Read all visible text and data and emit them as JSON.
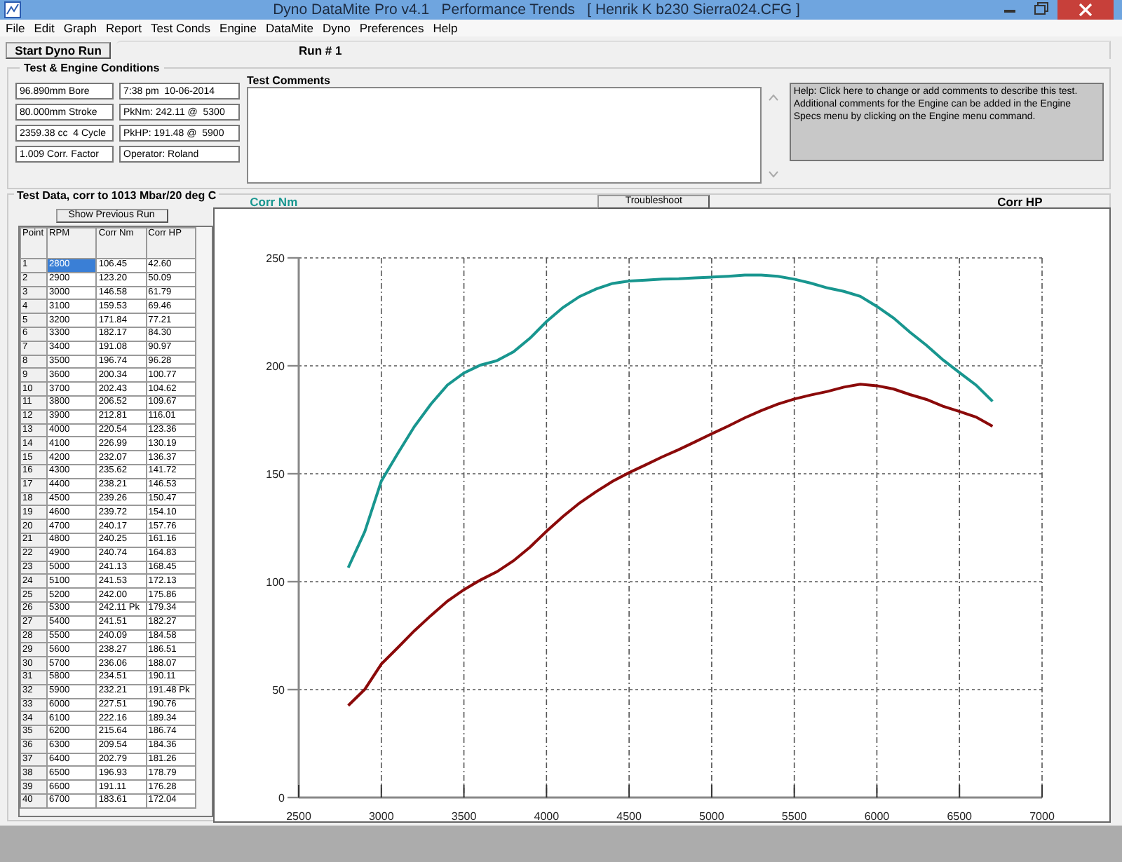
{
  "window": {
    "title": "Dyno DataMite Pro v4.1   Performance Trends   [ Henrik K b230 Sierra024.CFG ]"
  },
  "menu": [
    "File",
    "Edit",
    "Graph",
    "Report",
    "Test Conds",
    "Engine",
    "DataMite",
    "Dyno",
    "Preferences",
    "Help"
  ],
  "toolbar": {
    "start_button": "Start Dyno Run",
    "run_tab": "Run # 1"
  },
  "conditions": {
    "title": "Test & Engine Conditions",
    "fields": [
      "96.890mm Bore",
      "7:38 pm  10-06-2014",
      "80.000mm Stroke",
      "PkNm: 242.11 @  5300",
      "2359.38 cc  4 Cycle",
      "PkHP: 191.48 @  5900",
      "1.009 Corr. Factor",
      "Operator: Roland"
    ]
  },
  "comments": {
    "label": "Test Comments",
    "help": "Help:  Click here to change or add comments to describe this test.  Additional comments for the Engine can be added in the Engine Specs menu by clicking on the Engine menu command."
  },
  "test_data": {
    "title": "Test Data, corr to 1013 Mbar/20 deg C",
    "show_previous_button": "Show Previous Run",
    "columns": [
      "Point",
      "RPM",
      "Corr Nm",
      "Corr HP"
    ],
    "rows": [
      {
        "cells": [
          "1",
          "2800",
          "106.45",
          "42.60"
        ],
        "selected": true
      },
      {
        "cells": [
          "2",
          "2900",
          "123.20",
          "50.09"
        ],
        "selected": false
      },
      {
        "cells": [
          "3",
          "3000",
          "146.58",
          "61.79"
        ],
        "selected": false
      },
      {
        "cells": [
          "4",
          "3100",
          "159.53",
          "69.46"
        ],
        "selected": false
      },
      {
        "cells": [
          "5",
          "3200",
          "171.84",
          "77.21"
        ],
        "selected": false
      },
      {
        "cells": [
          "6",
          "3300",
          "182.17",
          "84.30"
        ],
        "selected": false
      },
      {
        "cells": [
          "7",
          "3400",
          "191.08",
          "90.97"
        ],
        "selected": false
      },
      {
        "cells": [
          "8",
          "3500",
          "196.74",
          "96.28"
        ],
        "selected": false
      },
      {
        "cells": [
          "9",
          "3600",
          "200.34",
          "100.77"
        ],
        "selected": false
      },
      {
        "cells": [
          "10",
          "3700",
          "202.43",
          "104.62"
        ],
        "selected": false
      },
      {
        "cells": [
          "11",
          "3800",
          "206.52",
          "109.67"
        ],
        "selected": false
      },
      {
        "cells": [
          "12",
          "3900",
          "212.81",
          "116.01"
        ],
        "selected": false
      },
      {
        "cells": [
          "13",
          "4000",
          "220.54",
          "123.36"
        ],
        "selected": false
      },
      {
        "cells": [
          "14",
          "4100",
          "226.99",
          "130.19"
        ],
        "selected": false
      },
      {
        "cells": [
          "15",
          "4200",
          "232.07",
          "136.37"
        ],
        "selected": false
      },
      {
        "cells": [
          "16",
          "4300",
          "235.62",
          "141.72"
        ],
        "selected": false
      },
      {
        "cells": [
          "17",
          "4400",
          "238.21",
          "146.53"
        ],
        "selected": false
      },
      {
        "cells": [
          "18",
          "4500",
          "239.26",
          "150.47"
        ],
        "selected": false
      },
      {
        "cells": [
          "19",
          "4600",
          "239.72",
          "154.10"
        ],
        "selected": false
      },
      {
        "cells": [
          "20",
          "4700",
          "240.17",
          "157.76"
        ],
        "selected": false
      },
      {
        "cells": [
          "21",
          "4800",
          "240.25",
          "161.16"
        ],
        "selected": false
      },
      {
        "cells": [
          "22",
          "4900",
          "240.74",
          "164.83"
        ],
        "selected": false
      },
      {
        "cells": [
          "23",
          "5000",
          "241.13",
          "168.45"
        ],
        "selected": false
      },
      {
        "cells": [
          "24",
          "5100",
          "241.53",
          "172.13"
        ],
        "selected": false
      },
      {
        "cells": [
          "25",
          "5200",
          "242.00",
          "175.86"
        ],
        "selected": false
      },
      {
        "cells": [
          "26",
          "5300",
          "242.11 Pk",
          "179.34"
        ],
        "selected": false
      },
      {
        "cells": [
          "27",
          "5400",
          "241.51",
          "182.27"
        ],
        "selected": false
      },
      {
        "cells": [
          "28",
          "5500",
          "240.09",
          "184.58"
        ],
        "selected": false
      },
      {
        "cells": [
          "29",
          "5600",
          "238.27",
          "186.51"
        ],
        "selected": false
      },
      {
        "cells": [
          "30",
          "5700",
          "236.06",
          "188.07"
        ],
        "selected": false
      },
      {
        "cells": [
          "31",
          "5800",
          "234.51",
          "190.11"
        ],
        "selected": false
      },
      {
        "cells": [
          "32",
          "5900",
          "232.21",
          "191.48 Pk"
        ],
        "selected": false
      },
      {
        "cells": [
          "33",
          "6000",
          "227.51",
          "190.76"
        ],
        "selected": false
      },
      {
        "cells": [
          "34",
          "6100",
          "222.16",
          "189.34"
        ],
        "selected": false
      },
      {
        "cells": [
          "35",
          "6200",
          "215.64",
          "186.74"
        ],
        "selected": false
      },
      {
        "cells": [
          "36",
          "6300",
          "209.54",
          "184.36"
        ],
        "selected": false
      },
      {
        "cells": [
          "37",
          "6400",
          "202.79",
          "181.26"
        ],
        "selected": false
      },
      {
        "cells": [
          "38",
          "6500",
          "196.93",
          "178.79"
        ],
        "selected": false
      },
      {
        "cells": [
          "39",
          "6600",
          "191.11",
          "176.28"
        ],
        "selected": false
      },
      {
        "cells": [
          "40",
          "6700",
          "183.61",
          "172.04"
        ],
        "selected": false
      }
    ]
  },
  "graph": {
    "troubleshoot_button": "Troubleshoot",
    "chart_data": {
      "type": "line",
      "grid": true,
      "x": [
        2800,
        2900,
        3000,
        3100,
        3200,
        3300,
        3400,
        3500,
        3600,
        3700,
        3800,
        3900,
        4000,
        4100,
        4200,
        4300,
        4400,
        4500,
        4600,
        4700,
        4800,
        4900,
        5000,
        5100,
        5200,
        5300,
        5400,
        5500,
        5600,
        5700,
        5800,
        5900,
        6000,
        6100,
        6200,
        6300,
        6400,
        6500,
        6600,
        6700
      ],
      "series": [
        {
          "name": "Corr Nm",
          "color": "#18968f",
          "values": [
            106.5,
            123.2,
            146.6,
            159.5,
            171.8,
            182.2,
            191.1,
            196.7,
            200.3,
            202.4,
            206.5,
            212.8,
            220.5,
            227.0,
            232.1,
            235.6,
            238.2,
            239.3,
            239.7,
            240.2,
            240.3,
            240.7,
            241.1,
            241.5,
            242.0,
            242.1,
            241.5,
            240.1,
            238.3,
            236.1,
            234.5,
            232.2,
            227.5,
            222.2,
            215.6,
            209.5,
            202.8,
            196.9,
            191.1,
            183.6
          ]
        },
        {
          "name": "Corr HP",
          "color": "#8b0a0a",
          "values": [
            42.6,
            50.1,
            61.8,
            69.5,
            77.2,
            84.3,
            91.0,
            96.3,
            100.8,
            104.6,
            109.7,
            116.0,
            123.4,
            130.2,
            136.4,
            141.7,
            146.5,
            150.5,
            154.1,
            157.8,
            161.2,
            164.8,
            168.5,
            172.1,
            175.9,
            179.3,
            182.3,
            184.6,
            186.5,
            188.1,
            190.1,
            191.5,
            190.8,
            189.3,
            186.7,
            184.4,
            181.3,
            178.8,
            176.3,
            172.0
          ]
        }
      ],
      "xlim": [
        2500,
        7000
      ],
      "ylim": [
        0,
        250
      ],
      "xticks": [
        2500,
        3000,
        3500,
        4000,
        4500,
        5000,
        5500,
        6000,
        6500,
        7000
      ],
      "yticks": [
        0,
        50,
        100,
        150,
        200,
        250
      ]
    }
  }
}
